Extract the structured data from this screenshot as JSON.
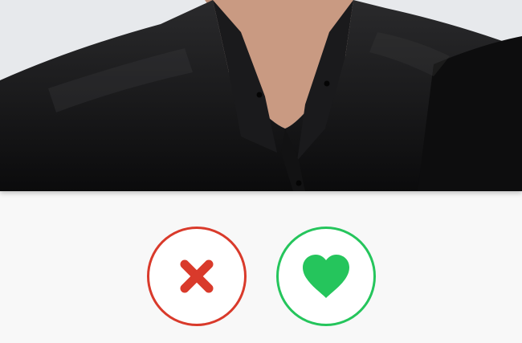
{
  "photo": {
    "icon": "profile-photo"
  },
  "actions": {
    "nope": {
      "icon": "close-icon",
      "color": "#d93a2b"
    },
    "like": {
      "icon": "heart-icon",
      "color": "#25c55c"
    }
  },
  "colors": {
    "background": "#f8f8f8",
    "nope_accent": "#d93a2b",
    "like_accent": "#25c55c"
  }
}
